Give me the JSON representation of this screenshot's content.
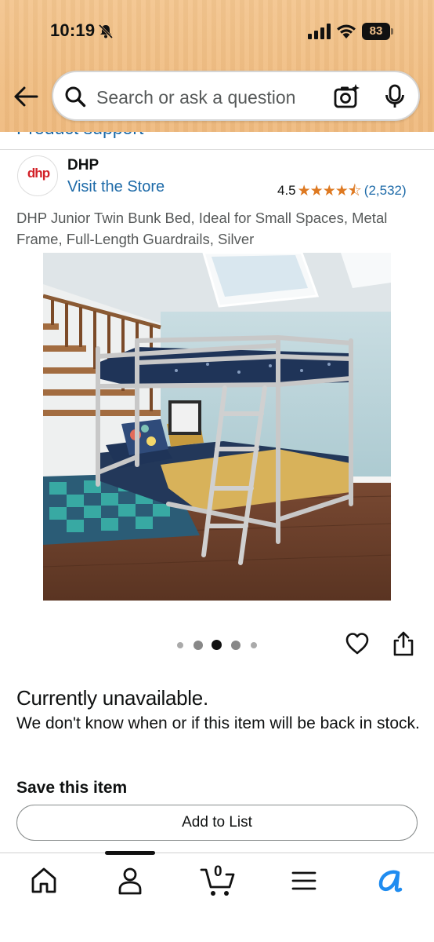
{
  "status_bar": {
    "time": "10:19",
    "battery": "83"
  },
  "search": {
    "placeholder": "Search or ask a question"
  },
  "partial_link": "Product support",
  "brand": {
    "logo_text": "dhp",
    "name": "DHP",
    "visit_store": "Visit the Store",
    "rating": "4.5",
    "stars": "★★★★⯪",
    "review_count": "(2,532)"
  },
  "product": {
    "title": "DHP Junior Twin Bunk Bed, Ideal for Small Spaces, Metal Frame, Full-Length Guardrails, Silver",
    "image_index": 3,
    "image_count": 5
  },
  "availability": {
    "heading": "Currently unavailable.",
    "message": "We don't know when or if this item will be back in stock."
  },
  "save_section": {
    "heading": "Save this item",
    "add_to_list": "Add to List"
  },
  "cart": {
    "count": "0"
  },
  "icons": {
    "back": "back-arrow-icon",
    "search": "search-icon",
    "camera": "camera-icon",
    "mic": "microphone-icon",
    "heart": "heart-icon",
    "share": "share-icon",
    "home": "home-icon",
    "account": "account-icon",
    "cart": "cart-icon",
    "menu": "menu-icon",
    "assistant": "assistant-icon"
  },
  "colors": {
    "header_bg": "#f0bd82",
    "link": "#1d6aa8",
    "star": "#de7921",
    "assistant": "#1f8cf0"
  }
}
